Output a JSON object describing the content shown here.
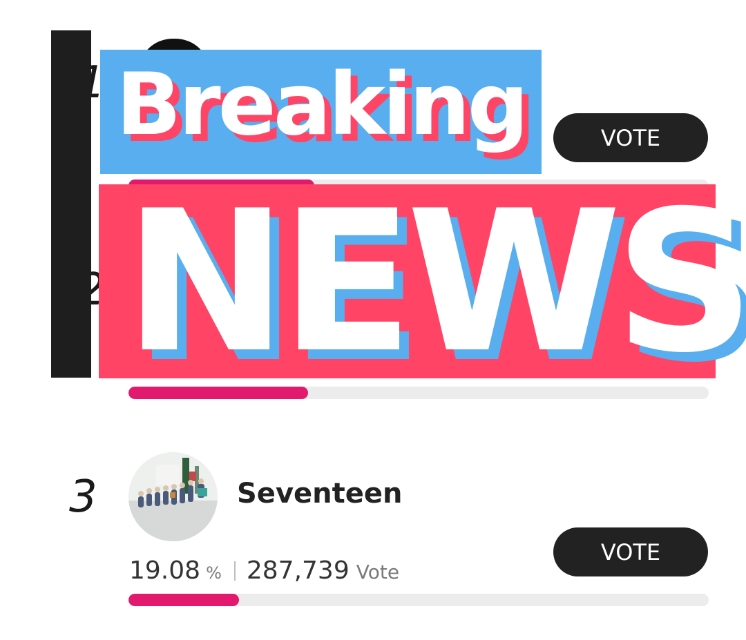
{
  "ranking": {
    "vote_label": "VOTE",
    "vote_unit": "Vote",
    "pct_unit": "%",
    "entries": [
      {
        "rank": "1",
        "progress": 0.32
      },
      {
        "rank": "2",
        "progress": 0.31
      },
      {
        "rank": "3",
        "name": "Seventeen",
        "percent": "19.08",
        "votes": "287,739",
        "progress": 0.19
      }
    ]
  },
  "overlay": {
    "breaking": "Breaking",
    "news": "NEWS"
  },
  "colors": {
    "accent": "#e2196c",
    "vote_button": "#222222",
    "news_pink": "#ff4466",
    "news_blue": "#58aeee"
  }
}
